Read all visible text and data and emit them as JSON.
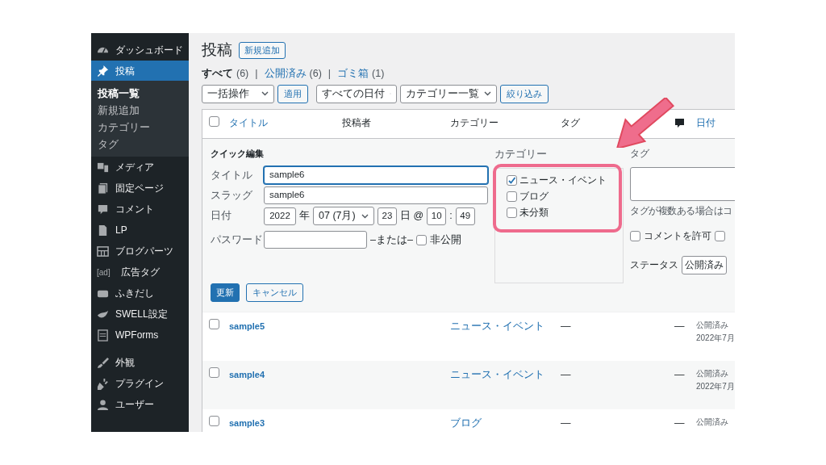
{
  "sidebar": {
    "groups": [
      {
        "items": [
          {
            "label": "ダッシュボード",
            "selected": false
          },
          {
            "label": "投稿",
            "selected": true,
            "children": [
              {
                "label": "投稿一覧",
                "selected": true
              },
              {
                "label": "新規追加",
                "selected": false
              },
              {
                "label": "カテゴリー",
                "selected": false
              },
              {
                "label": "タグ",
                "selected": false
              }
            ]
          },
          {
            "label": "メディア",
            "selected": false
          },
          {
            "label": "固定ページ",
            "selected": false
          },
          {
            "label": "コメント",
            "selected": false
          },
          {
            "label": "LP",
            "selected": false
          },
          {
            "label": "ブログパーツ",
            "selected": false
          },
          {
            "label": "広告タグ",
            "selected": false,
            "icon_text": "[ad]"
          },
          {
            "label": "ふきだし",
            "selected": false
          },
          {
            "label": "SWELL設定",
            "selected": false
          },
          {
            "label": "WPForms",
            "selected": false
          }
        ]
      },
      {
        "items": [
          {
            "label": "外観",
            "selected": false
          },
          {
            "label": "プラグイン",
            "selected": false
          },
          {
            "label": "ユーザー",
            "selected": false
          }
        ]
      }
    ]
  },
  "page": {
    "title": "投稿",
    "add_new_button": "新規追加",
    "view_separator": "|",
    "views": [
      {
        "label": "すべて",
        "count": "(6)",
        "selected": true
      },
      {
        "label": "公開済み",
        "count": "(6)",
        "selected": false
      },
      {
        "label": "ゴミ箱",
        "count": "(1)",
        "selected": false
      }
    ],
    "filters": [
      {
        "kind": "select",
        "value": "一括操作"
      },
      {
        "kind": "button",
        "label": "適用"
      },
      {
        "kind": "select",
        "value": "すべての日付"
      },
      {
        "kind": "select",
        "value": "カテゴリー一覧"
      },
      {
        "kind": "button",
        "label": "絞り込み"
      }
    ]
  },
  "table": {
    "select_all_checked": false,
    "columns": [
      {
        "kind": "sortable",
        "label": "タイトル"
      },
      {
        "kind": "plain",
        "label": "投稿者"
      },
      {
        "kind": "plain",
        "label": "カテゴリー"
      },
      {
        "kind": "plain",
        "label": "タグ"
      },
      {
        "kind": "comment-icon"
      },
      {
        "kind": "sortable",
        "label": "日付"
      }
    ],
    "quick_edit": {
      "heading": "クイック編集",
      "fields": [
        {
          "label": "タイトル",
          "value": "sample6",
          "focused": true
        },
        {
          "label": "スラッグ",
          "value": "sample6",
          "focused": false
        }
      ],
      "date": {
        "label": "日付",
        "year": "2022",
        "year_unit": "年",
        "month": "07 (7月)",
        "day": "23",
        "day_unit": "日 @",
        "hour": "10",
        "colon": ":",
        "minute": "49"
      },
      "password": {
        "label": "パスワード",
        "or_text": "–または–",
        "private_label": "非公開",
        "private_checked": false
      },
      "categories": {
        "label": "カテゴリー",
        "items": [
          {
            "label": "ニュース・イベント",
            "checked": true
          },
          {
            "label": "ブログ",
            "checked": false
          },
          {
            "label": "未分類",
            "checked": false
          }
        ]
      },
      "tags": {
        "label": "タグ",
        "hint": "タグが複数ある場合はコ"
      },
      "options": [
        {
          "label": "コメントを許可",
          "checked": false
        },
        {
          "checked": false
        }
      ],
      "status": {
        "label": "ステータス",
        "value": "公開済み"
      },
      "update_button": "更新",
      "cancel_button": "キャンセル"
    },
    "rows": [
      {
        "title": "sample5",
        "category": "ニュース・イベント",
        "tags": "—",
        "comments": "—",
        "status": "公開済み",
        "date": "2022年7月",
        "checked": false
      },
      {
        "title": "sample4",
        "category": "ニュース・イベント",
        "tags": "—",
        "comments": "—",
        "status": "公開済み",
        "date": "2022年7月",
        "checked": false
      },
      {
        "title": "sample3",
        "category": "ブログ",
        "tags": "—",
        "comments": "—",
        "status": "公開済み",
        "checked": false
      }
    ]
  }
}
